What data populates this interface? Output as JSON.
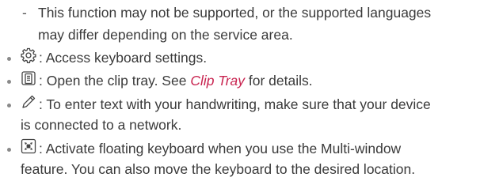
{
  "note": {
    "dash": "-",
    "line1": "This function may not be supported, or the supported languages",
    "line2": "may differ depending on the service area."
  },
  "items": [
    {
      "icon": "gear-icon",
      "text": ": Access keyboard settings."
    },
    {
      "icon": "clipboard-icon",
      "text_before": ": Open the clip tray. See ",
      "link": "Clip Tray",
      "text_after": " for details."
    },
    {
      "icon": "pen-icon",
      "line1": ": To enter text with your handwriting, make sure that your device",
      "line2": "is connected to a network."
    },
    {
      "icon": "floating-keyboard-icon",
      "line1": ": Activate floating keyboard when you use the Multi-window",
      "line2": "feature. You can also move the keyboard to the desired location."
    }
  ],
  "colors": {
    "text": "#3a3a3a",
    "link": "#c8234f",
    "bullet": "#8a8a8a"
  }
}
